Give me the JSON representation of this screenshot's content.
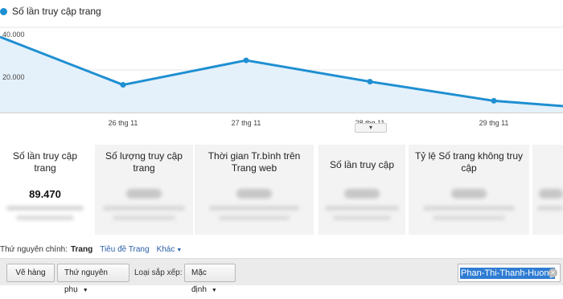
{
  "legend": {
    "label": "Số lần truy cập trang",
    "color": "#1f8fd1"
  },
  "chart_data": {
    "type": "area",
    "series": [
      {
        "name": "Số lần truy cập trang",
        "values": [
          35500,
          13000,
          24500,
          14500,
          5500,
          3000
        ]
      }
    ],
    "x": [
      "",
      "26 thg 11",
      "27 thg 11",
      "28 thg 11",
      "29 thg 11",
      ""
    ],
    "ylim": [
      0,
      40000
    ],
    "yticks": [
      {
        "value": 40000,
        "label": "40.000"
      },
      {
        "value": 20000,
        "label": "20.000"
      }
    ],
    "xticks": [
      "26 thg 11",
      "27 thg 11",
      "28 thg 11",
      "29 thg 11"
    ],
    "grid": true,
    "line_color": "#1f8fd1",
    "fill_color": "#e4f1fb"
  },
  "cards": [
    {
      "title": "Số lần truy cập trang",
      "value": "89.470"
    },
    {
      "title": "Số lượng truy cập trang",
      "value": ""
    },
    {
      "title": "Thời gian Tr.bình trên Trang web",
      "value": ""
    },
    {
      "title": "Số lần truy cập",
      "value": ""
    },
    {
      "title": "Tỷ lệ Số trang không truy cập",
      "value": ""
    }
  ],
  "dimension": {
    "label": "Thứ nguyên chính:",
    "current": "Trang",
    "links": [
      "Tiêu đề Trang",
      "Khác"
    ]
  },
  "toolbar": {
    "rows_button": "Vẽ hàng",
    "secondary_dim": "Thứ nguyên phụ",
    "sort_label": "Loại sắp xếp:",
    "sort_value": "Mặc định",
    "search_value": "Phan-Thi-Thanh-Huong"
  }
}
